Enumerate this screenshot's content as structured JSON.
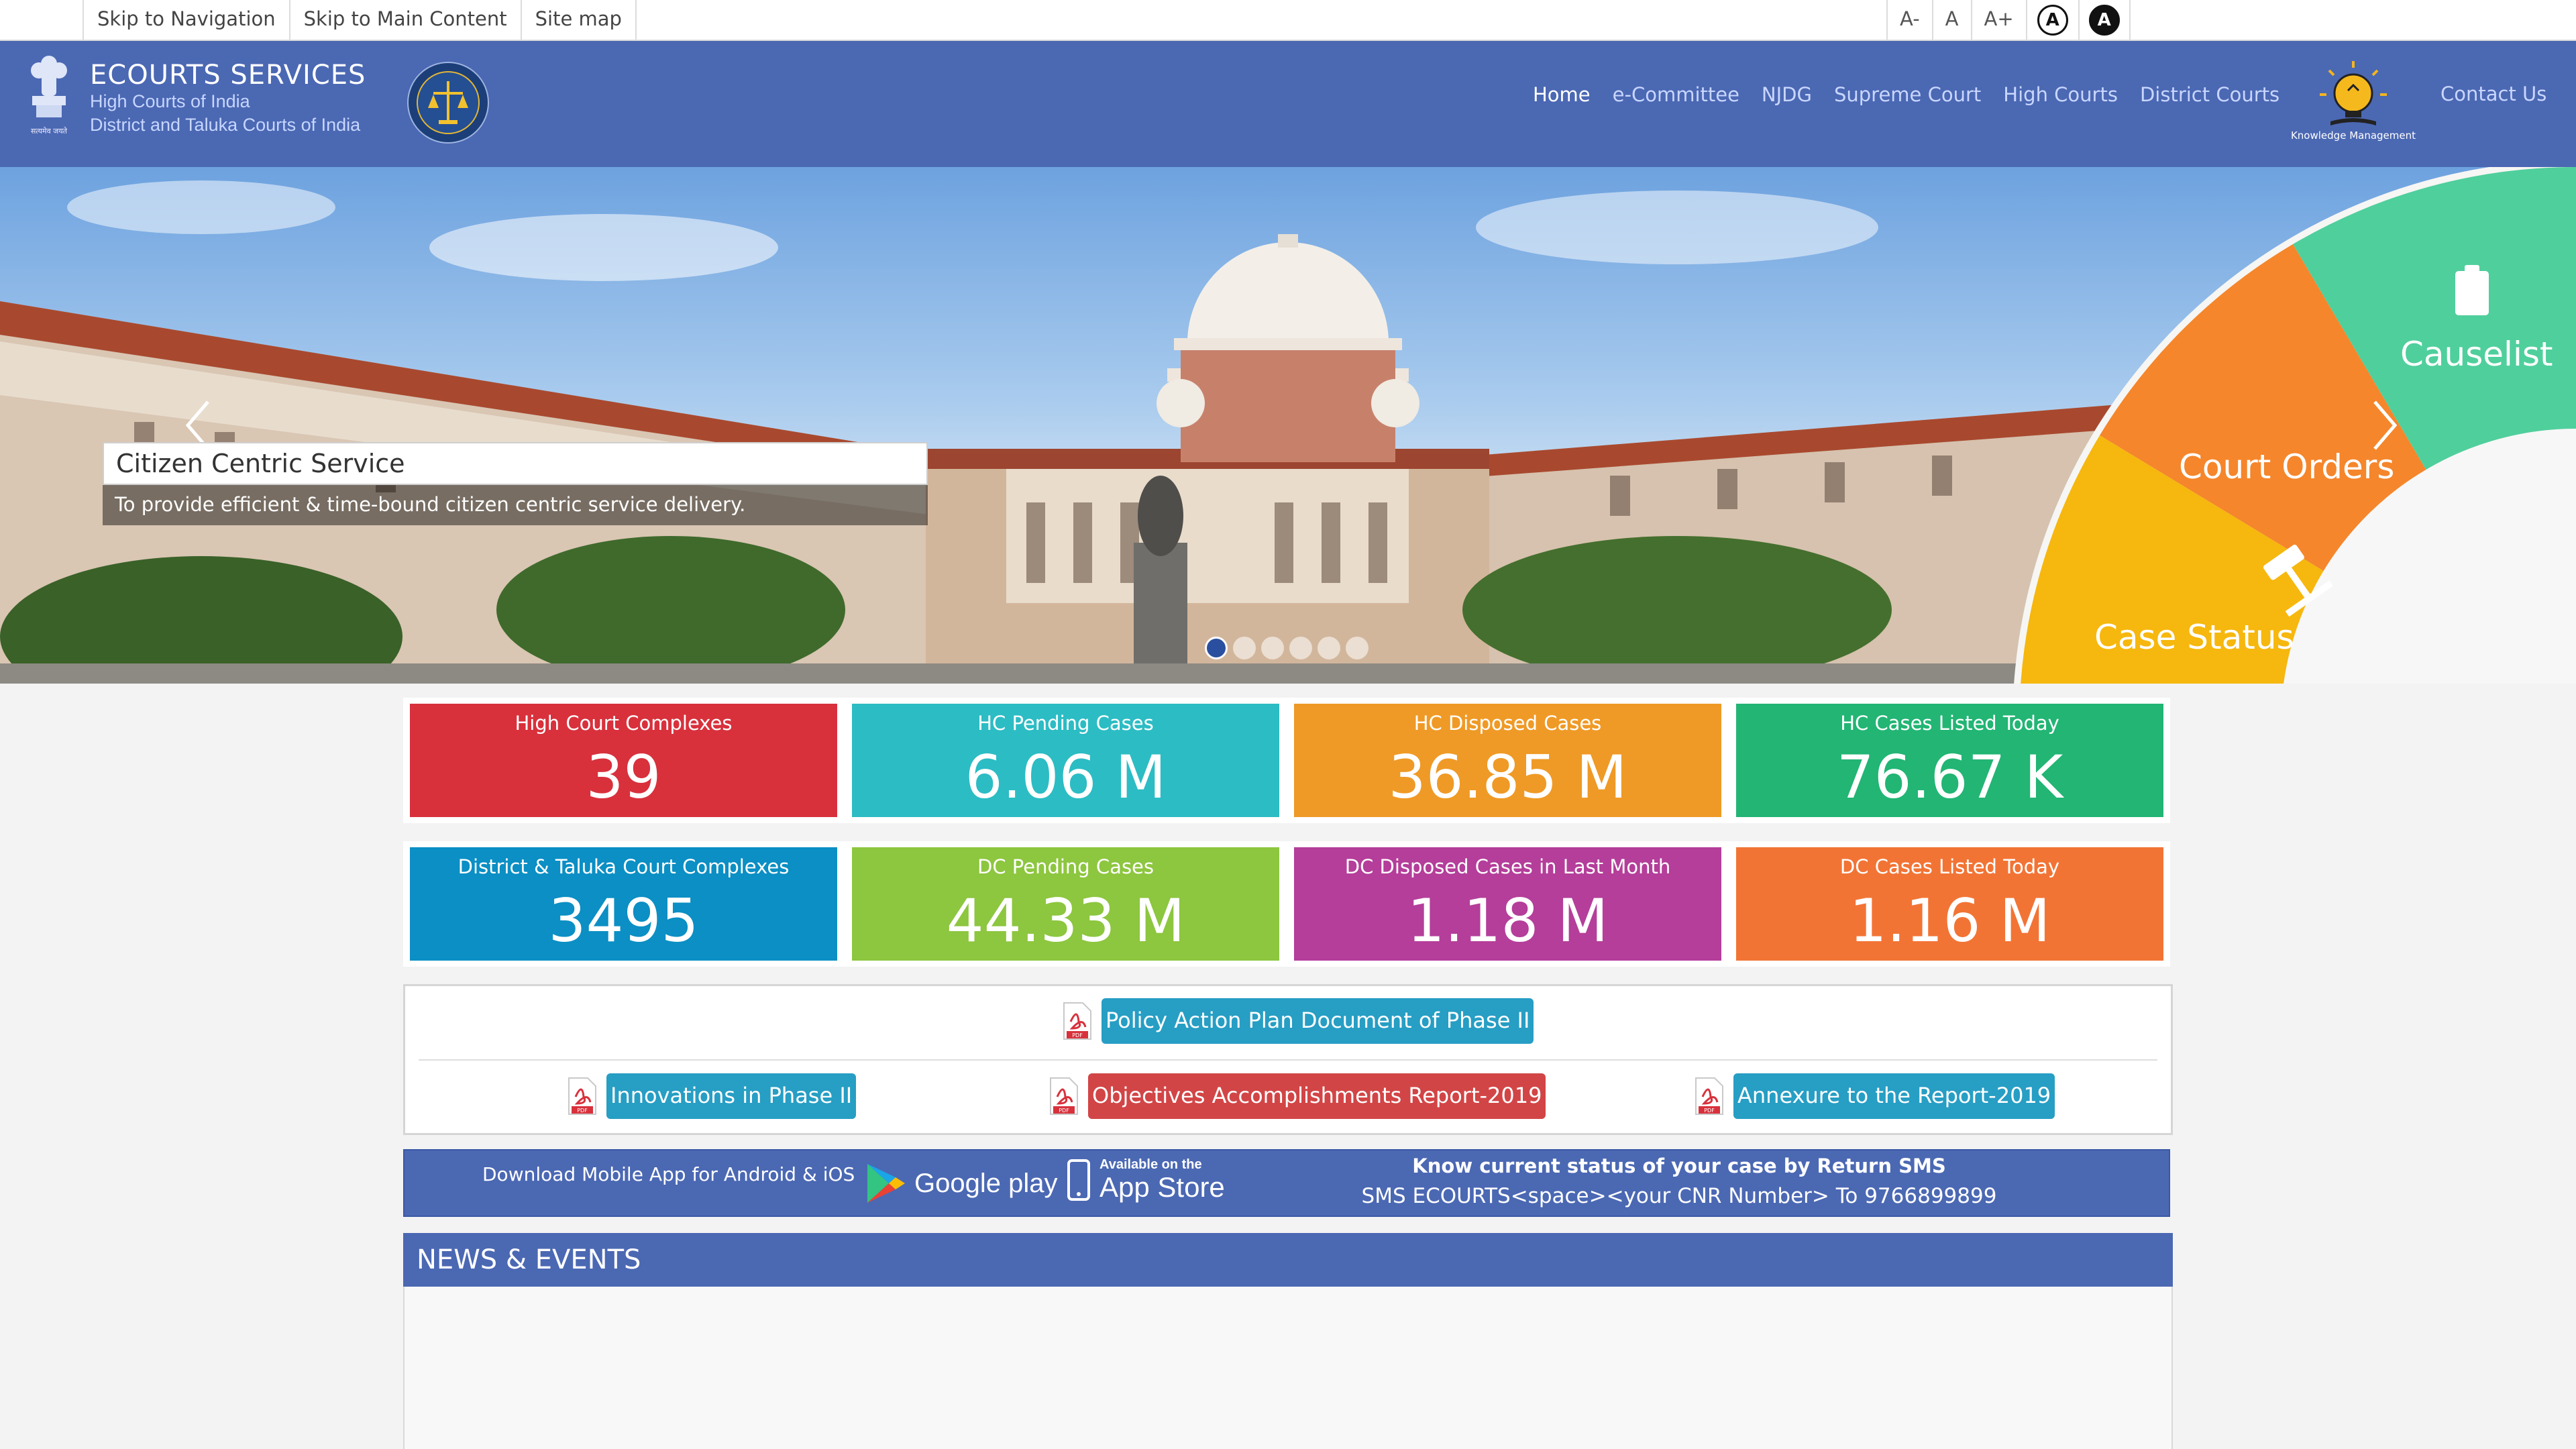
{
  "topbar": {
    "skip_links": [
      "Skip to Navigation",
      "Skip to Main Content",
      "Site map"
    ],
    "font_controls": [
      "A-",
      "A",
      "A+"
    ],
    "contrast_light": "A",
    "contrast_dark": "A"
  },
  "header": {
    "emblem_caption": "सत्यमेव जयते",
    "title": "ECOURTS SERVICES",
    "subtitle_1": "High Courts of India",
    "subtitle_2": "District and Taluka Courts of India",
    "nav": [
      "Home",
      "e-Committee",
      "NJDG",
      "Supreme Court",
      "High Courts",
      "District Courts"
    ],
    "km_label": "Knowledge Management",
    "contact": "Contact Us",
    "colors": {
      "header_bg": "#4b68b3",
      "nav_active": "#ffffff",
      "nav_link": "#c9d6ff"
    }
  },
  "hero": {
    "caption_title": "Citizen Centric Service",
    "caption_text": "To provide efficient & time-bound citizen centric service delivery.",
    "slide_count": 6,
    "active_slide": 1,
    "wheel": [
      {
        "label": "Causelist",
        "icon": "clipboard-icon",
        "color": "#4fcf9c"
      },
      {
        "label": "Court Orders",
        "icon": "gavel-icon",
        "color": "#f5862b"
      },
      {
        "label": "Case Status",
        "icon": "scales-icon",
        "color": "#f6b70e"
      }
    ]
  },
  "stats": {
    "row1": [
      {
        "label": "High Court Complexes",
        "value": "39",
        "color": "#d8313c"
      },
      {
        "label": "HC Pending Cases",
        "value": "6.06 M",
        "color": "#2cbcc4"
      },
      {
        "label": "HC Disposed Cases",
        "value": "36.85 M",
        "color": "#ef9a26"
      },
      {
        "label": "HC Cases Listed Today",
        "value": "76.67 K",
        "color": "#22b574"
      }
    ],
    "row2": [
      {
        "label": "District & Taluka Court Complexes",
        "value": "3495",
        "color": "#0b8fc4"
      },
      {
        "label": "DC Pending Cases",
        "value": "44.33 M",
        "color": "#8dc63f"
      },
      {
        "label": "DC Disposed Cases in Last Month",
        "value": "1.18 M",
        "color": "#b43e9a"
      },
      {
        "label": "DC Cases Listed Today",
        "value": "1.16 M",
        "color": "#f27435"
      }
    ]
  },
  "documents": {
    "pdf_tag": "PDF",
    "main": "Policy Action Plan Document of Phase II",
    "items": [
      "Innovations in Phase II",
      "Objectives Accomplishments Report-2019",
      "Annexure to the Report-2019"
    ]
  },
  "app_bar": {
    "download_text": "Download Mobile App for Android & iOS",
    "google_play": "Google play",
    "app_store_small": "Available on the",
    "app_store_big": "App Store",
    "sms_title": "Know current status of your case by Return SMS",
    "sms_text": "SMS ECOURTS<space><your CNR Number> To 9766899899"
  },
  "news": {
    "title": "NEWS & EVENTS"
  }
}
